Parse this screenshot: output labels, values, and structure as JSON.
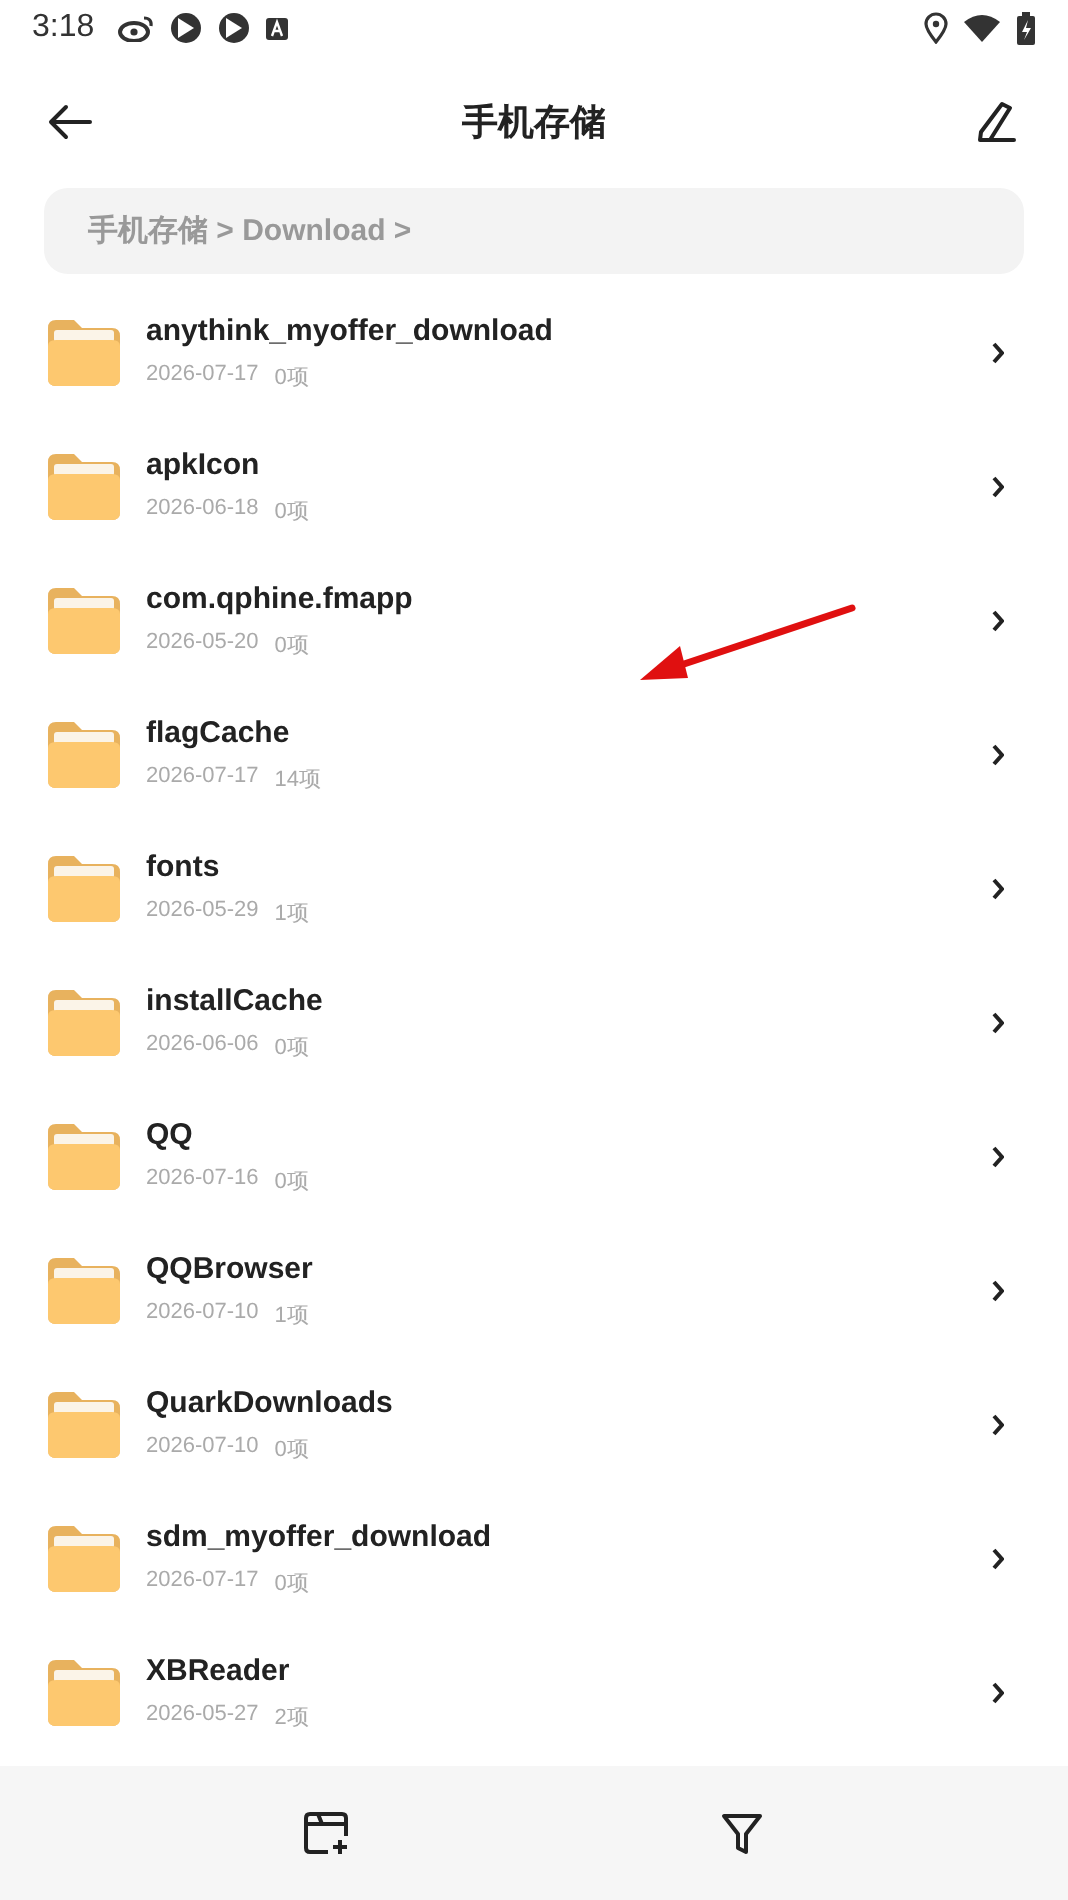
{
  "status_bar": {
    "time": "3:18"
  },
  "header": {
    "title": "手机存储"
  },
  "breadcrumb": {
    "path": "手机存储 > Download >"
  },
  "folders": [
    {
      "name": "anythink_myoffer_download",
      "date": "2026-07-17",
      "count": "0项"
    },
    {
      "name": "apkIcon",
      "date": "2026-06-18",
      "count": "0项"
    },
    {
      "name": "com.qphine.fmapp",
      "date": "2026-05-20",
      "count": "0项"
    },
    {
      "name": "flagCache",
      "date": "2026-07-17",
      "count": "14项"
    },
    {
      "name": "fonts",
      "date": "2026-05-29",
      "count": "1项"
    },
    {
      "name": "installCache",
      "date": "2026-06-06",
      "count": "0项"
    },
    {
      "name": "QQ",
      "date": "2026-07-16",
      "count": "0项"
    },
    {
      "name": "QQBrowser",
      "date": "2026-07-10",
      "count": "1项"
    },
    {
      "name": "QuarkDownloads",
      "date": "2026-07-10",
      "count": "0项"
    },
    {
      "name": "sdm_myoffer_download",
      "date": "2026-07-17",
      "count": "0项"
    },
    {
      "name": "XBReader",
      "date": "2026-05-27",
      "count": "2项"
    }
  ]
}
